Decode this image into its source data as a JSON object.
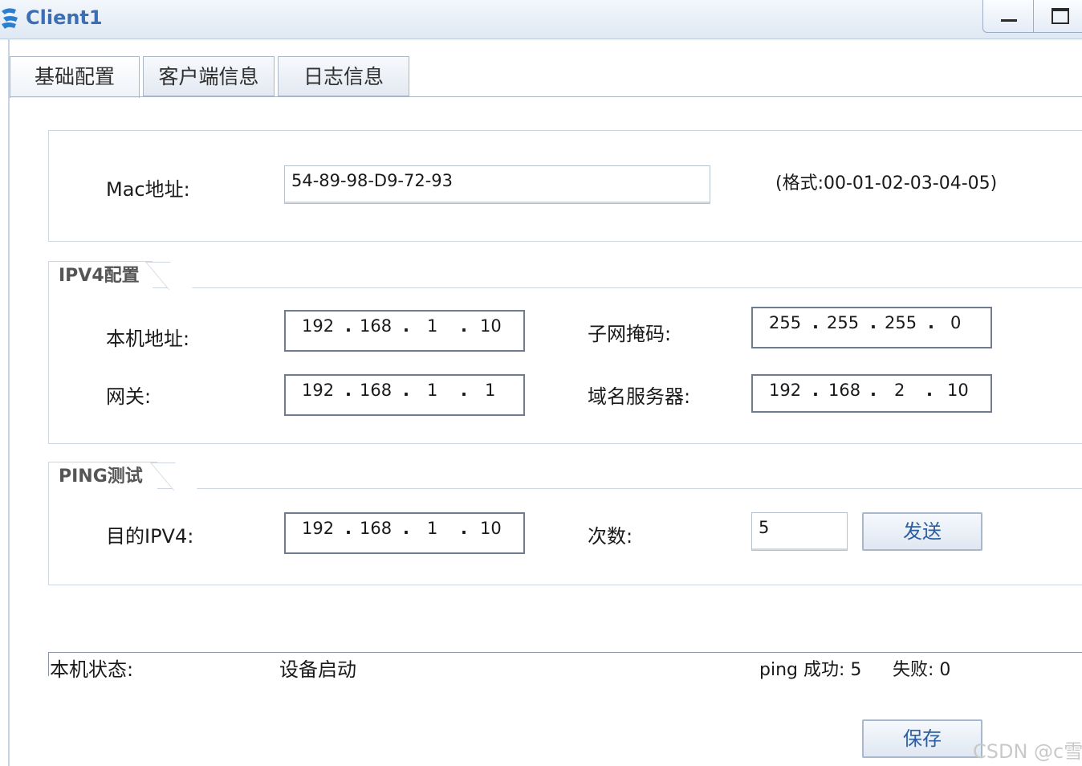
{
  "window": {
    "title": "Client1"
  },
  "tabs": [
    {
      "label": "基础配置",
      "active": true
    },
    {
      "label": "客户端信息",
      "active": false
    },
    {
      "label": "日志信息",
      "active": false
    }
  ],
  "mac": {
    "label": "Mac地址:",
    "value": "54-89-98-D9-72-93",
    "format_hint": "(格式:00-01-02-03-04-05)"
  },
  "ipv4": {
    "legend": "IPV4配置",
    "host_ip": {
      "label": "本机地址:",
      "octets": [
        "192",
        "168",
        "1",
        "10"
      ]
    },
    "subnet_mask": {
      "label": "子网掩码:",
      "octets": [
        "255",
        "255",
        "255",
        "0"
      ]
    },
    "gateway": {
      "label": "网关:",
      "octets": [
        "192",
        "168",
        "1",
        "1"
      ]
    },
    "dns": {
      "label": "域名服务器:",
      "octets": [
        "192",
        "168",
        "2",
        "10"
      ]
    }
  },
  "ping": {
    "legend": "PING测试",
    "target": {
      "label": "目的IPV4:",
      "octets": [
        "192",
        "168",
        "1",
        "10"
      ]
    },
    "count": {
      "label": "次数:",
      "value": "5"
    },
    "send_label": "发送"
  },
  "status": {
    "label": "本机状态:",
    "value": "设备启动",
    "ping_success": "ping 成功: 5",
    "ping_fail": "失败: 0"
  },
  "save_label": "保存",
  "watermark": "CSDN @c雪",
  "colors": {
    "title": "#3b6fb3",
    "button_text": "#2e5d9f"
  }
}
